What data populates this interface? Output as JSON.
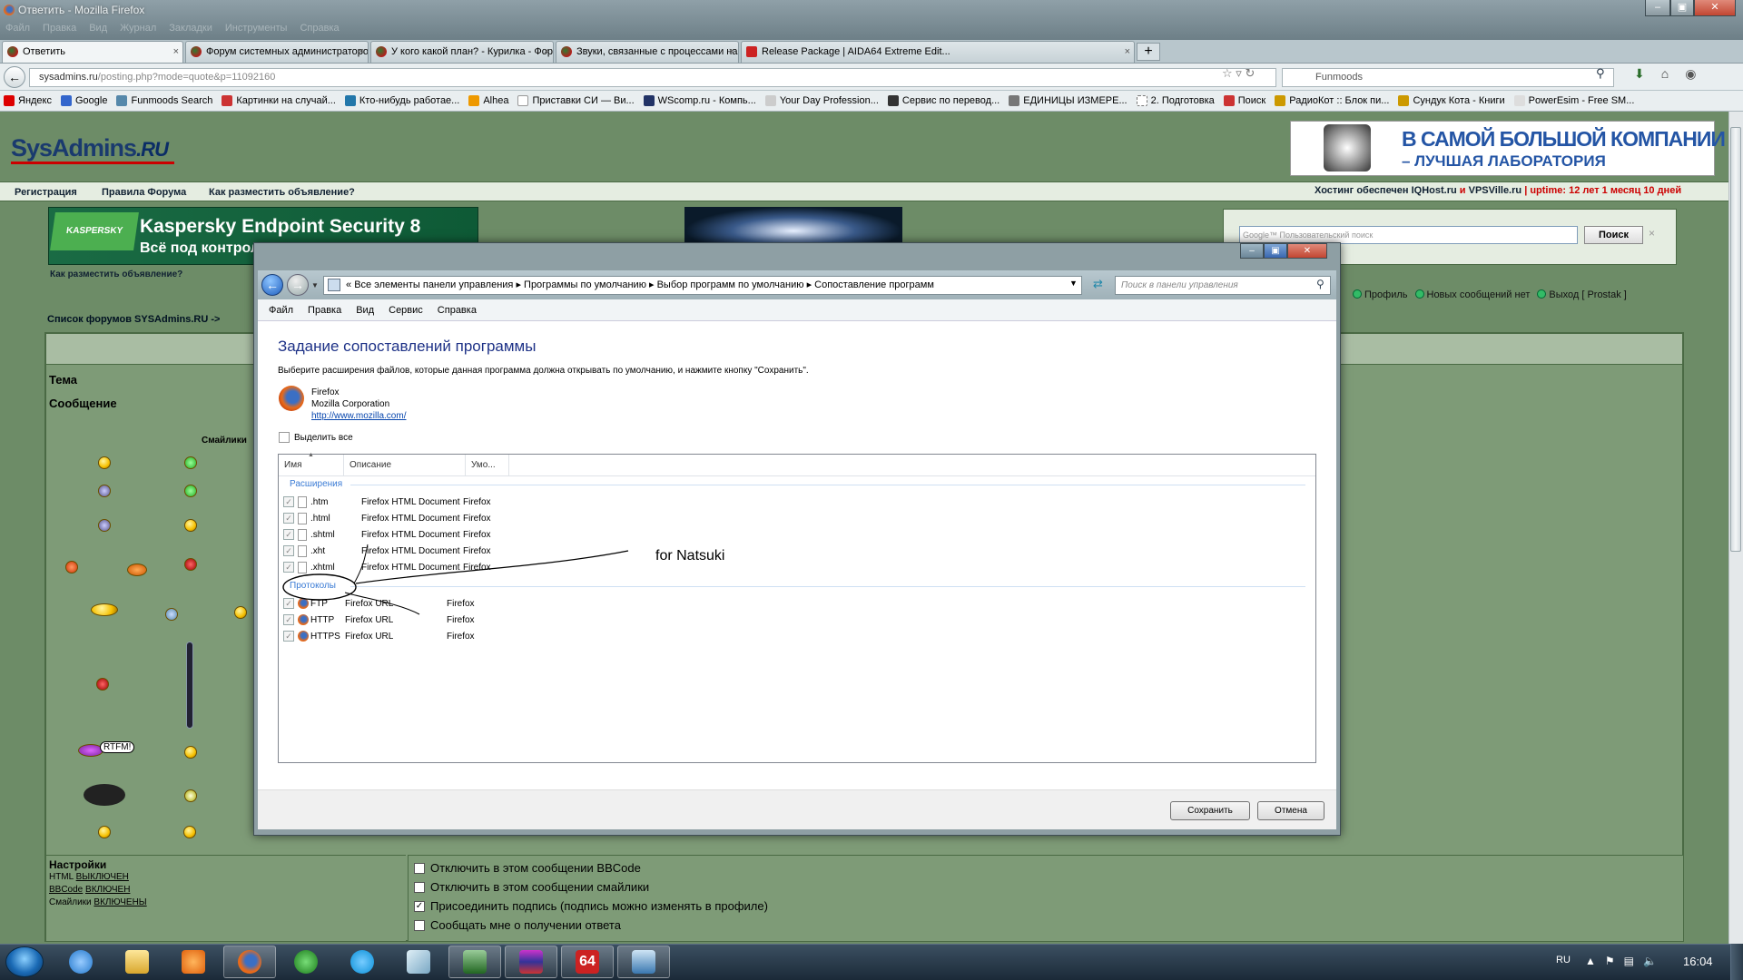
{
  "window": {
    "title": "Ответить - Mozilla Firefox",
    "menu": [
      "Файл",
      "Правка",
      "Вид",
      "Журнал",
      "Закладки",
      "Инструменты",
      "Справка"
    ]
  },
  "tabs": [
    {
      "label": "Ответить",
      "active": true
    },
    {
      "label": "Форум системных администраторов ..."
    },
    {
      "label": "У кого какой план? - Курилка - Фору..."
    },
    {
      "label": "Звуки, связанные с процессами на ..."
    },
    {
      "label": "Release Package | AIDA64 Extreme Edit..."
    }
  ],
  "navbar": {
    "url_domain": "sysadmins.ru",
    "url_path": "/posting.php?mode=quote&p=11092160",
    "search_value": "Funmoods"
  },
  "bookmarks": [
    "Яндекс",
    "Google",
    "Funmoods Search",
    "Картинки на случай...",
    "Кто-нибудь работае...",
    "Alhea",
    "Приставки СИ — Ви...",
    "WScomp.ru - Компь...",
    "Your Day Profession...",
    "Сервис по перевод...",
    "ЕДИНИЦЫ ИЗМЕРЕ...",
    "2. Подготовка",
    "Поиск",
    "РадиоКот :: Блок пи...",
    "Сундук Кота - Книги",
    "PowerEsim - Free SM..."
  ],
  "site": {
    "logo_main": "SysAdmins",
    "logo_suffix": ".RU",
    "ad_right_line1": "В САМОЙ БОЛЬШОЙ КОМПАНИИ",
    "ad_right_line2": "– ЛУЧШАЯ ЛАБОРАТОРИЯ",
    "nav_links": [
      "Регистрация",
      "Правила Форума",
      "Как разместить объявление?"
    ],
    "hosting_prefix": "Хостинг обеспечен IQHost.ru",
    "hosting_and": "и",
    "hosting_second": "VPSVille.ru",
    "uptime": "| uptime: 12 лет 1 месяц 10 дней",
    "kaspersky_brand": "KASPERSKY",
    "kaspersky_line1": "Kaspersky Endpoint Security 8",
    "kaspersky_line2": "Всё под контрол",
    "ad_howto": "Как разместить объявление?",
    "google_placeholder": "Пользовательский поиск",
    "google_brand": "Google™",
    "google_button": "Поиск",
    "forum_list": "Список форумов SYSAdmins.RU ->",
    "profile": "Профиль",
    "no_new": "Новых сообщений нет",
    "logout": "Выход [ Prostak ]",
    "label_topic": "Тема",
    "label_message": "Сообщение",
    "label_smilies": "Смайлики",
    "settings_title": "Настройки",
    "settings": [
      {
        "label": "HTML",
        "value": "ВЫКЛЮЧЕН"
      },
      {
        "label": "BBCode",
        "value": "ВКЛЮЧЕН"
      },
      {
        "label": "Смайлики",
        "value": "ВКЛЮЧЕНЫ"
      }
    ],
    "options": [
      {
        "label": "Отключить в этом сообщении BBCode",
        "checked": false
      },
      {
        "label": "Отключить в этом сообщении смайлики",
        "checked": false
      },
      {
        "label": "Присоединить подпись (подпись можно изменять в профиле)",
        "checked": true
      },
      {
        "label": "Сообщать мне о получении ответа",
        "checked": false
      }
    ]
  },
  "dialog": {
    "breadcrumb": [
      "Все элементы панели управления",
      "Программы по умолчанию",
      "Выбор программ по умолчанию",
      "Сопоставление программ"
    ],
    "search_placeholder": "Поиск в панели управления",
    "menu": [
      "Файл",
      "Правка",
      "Вид",
      "Сервис",
      "Справка"
    ],
    "heading": "Задание сопоставлений программы",
    "description": "Выберите расширения файлов, которые данная программа должна открывать по умолчанию, и нажмите кнопку \"Сохранить\".",
    "program_name": "Firefox",
    "program_company": "Mozilla Corporation",
    "program_url": "http://www.mozilla.com/",
    "select_all": "Выделить все",
    "columns": [
      "Имя",
      "Описание",
      "Умо..."
    ],
    "group_extensions": "Расширения",
    "group_protocols": "Протоколы",
    "extensions": [
      {
        "name": ".htm",
        "desc": "Firefox HTML Document",
        "default": "Firefox"
      },
      {
        "name": ".html",
        "desc": "Firefox HTML Document",
        "default": "Firefox"
      },
      {
        "name": ".shtml",
        "desc": "Firefox HTML Document",
        "default": "Firefox"
      },
      {
        "name": ".xht",
        "desc": "Firefox HTML Document",
        "default": "Firefox"
      },
      {
        "name": ".xhtml",
        "desc": "Firefox HTML Document",
        "default": "Firefox"
      }
    ],
    "protocols": [
      {
        "name": "FTP",
        "desc": "Firefox URL",
        "default": "Firefox"
      },
      {
        "name": "HTTP",
        "desc": "Firefox URL",
        "default": "Firefox"
      },
      {
        "name": "HTTPS",
        "desc": "Firefox URL",
        "default": "Firefox"
      }
    ],
    "save": "Сохранить",
    "cancel": "Отмена",
    "annotation": "for Natsuki"
  },
  "taskbar": {
    "lang": "RU",
    "clock": "16:04"
  }
}
